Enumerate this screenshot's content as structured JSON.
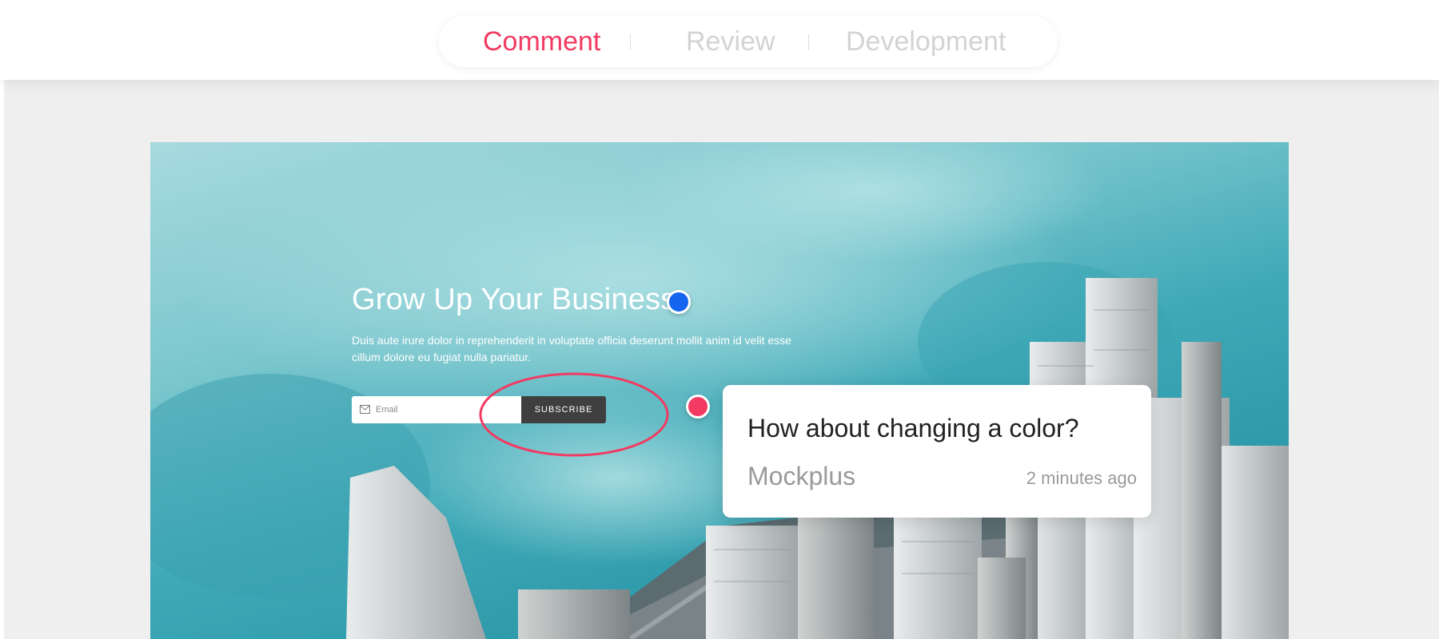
{
  "tabs": [
    {
      "label": "Comment",
      "active": true
    },
    {
      "label": "Review",
      "active": false
    },
    {
      "label": "Development",
      "active": false
    }
  ],
  "hero": {
    "title": "Grow Up Your Business",
    "description": "Duis aute irure dolor in reprehenderit in voluptate officia deserunt mollit anim id velit esse cillum dolore eu fugiat nulla pariatur.",
    "email_placeholder": "Email",
    "subscribe_label": "SUBSCRIBE"
  },
  "comment": {
    "text": "How about changing a color?",
    "author": "Mockplus",
    "time": "2 minutes ago"
  },
  "colors": {
    "accent": "#f23a62",
    "marker_blue": "#1565ef",
    "tab_inactive": "#d3d3d3",
    "button_dark": "#3f3f3f"
  },
  "icons": {
    "email": "mail-icon"
  }
}
